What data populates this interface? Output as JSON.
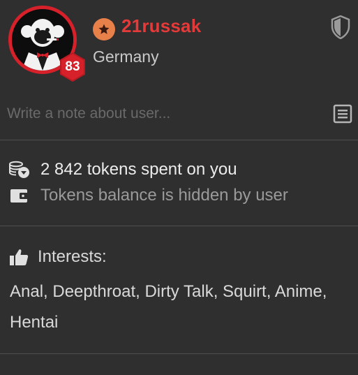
{
  "user": {
    "username": "21russak",
    "country": "Germany",
    "level": "83",
    "rank_icon": "star-badge-icon",
    "avatar": "smoking-monkey-tuxedo-avatar"
  },
  "note": {
    "placeholder": "Write a note about user...",
    "value": ""
  },
  "tokens": {
    "spent_text": "2 842 tokens spent on you",
    "balance_text": "Tokens balance is hidden by user"
  },
  "interests": {
    "label": "Interests:",
    "list_text": "Anal, Deepthroat, Dirty Talk, Squirt, Anime, Hentai"
  },
  "colors": {
    "background": "#2f2f2f",
    "username": "#e53a3a",
    "avatar_ring": "#d6212a",
    "level_badge": "#d6212a",
    "rank_badge": "#e8804a",
    "muted_text": "#9a9a9a",
    "divider": "#4e4e4e"
  }
}
